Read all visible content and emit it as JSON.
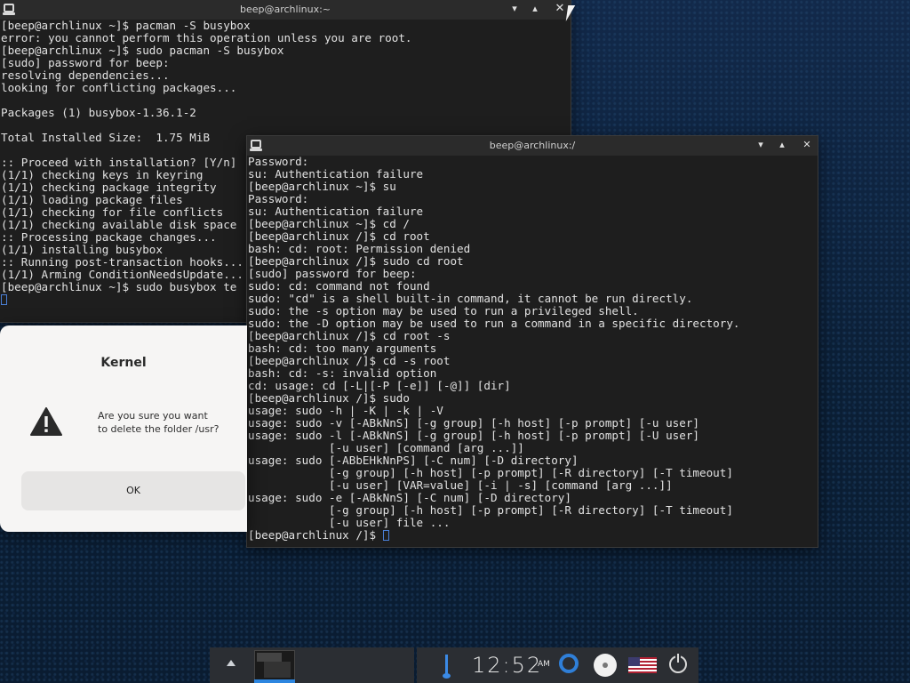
{
  "terminal1": {
    "title": "beep@archlinux:~",
    "minimize": "▾",
    "maximize": "▴",
    "close": "✕",
    "lines": [
      "[beep@archlinux ~]$ pacman -S busybox",
      "error: you cannot perform this operation unless you are root.",
      "[beep@archlinux ~]$ sudo pacman -S busybox",
      "[sudo] password for beep:",
      "resolving dependencies...",
      "looking for conflicting packages...",
      "",
      "Packages (1) busybox-1.36.1-2",
      "",
      "Total Installed Size:  1.75 MiB",
      "",
      ":: Proceed with installation? [Y/n]",
      "(1/1) checking keys in keyring",
      "(1/1) checking package integrity",
      "(1/1) loading package files",
      "(1/1) checking for file conflicts",
      "(1/1) checking available disk space",
      ":: Processing package changes...",
      "(1/1) installing busybox",
      ":: Running post-transaction hooks...",
      "(1/1) Arming ConditionNeedsUpdate...",
      "[beep@archlinux ~]$ sudo busybox te"
    ]
  },
  "terminal2": {
    "title": "beep@archlinux:/",
    "minimize": "▾",
    "maximize": "▴",
    "close": "✕",
    "lines": [
      "Password:",
      "su: Authentication failure",
      "[beep@archlinux ~]$ su",
      "Password:",
      "su: Authentication failure",
      "[beep@archlinux ~]$ cd /",
      "[beep@archlinux /]$ cd root",
      "bash: cd: root: Permission denied",
      "[beep@archlinux /]$ sudo cd root",
      "[sudo] password for beep:",
      "sudo: cd: command not found",
      "sudo: \"cd\" is a shell built-in command, it cannot be run directly.",
      "sudo: the -s option may be used to run a privileged shell.",
      "sudo: the -D option may be used to run a command in a specific directory.",
      "[beep@archlinux /]$ cd root -s",
      "bash: cd: too many arguments",
      "[beep@archlinux /]$ cd -s root",
      "bash: cd: -s: invalid option",
      "cd: usage: cd [-L|[-P [-e]] [-@]] [dir]",
      "[beep@archlinux /]$ sudo",
      "usage: sudo -h | -K | -k | -V",
      "usage: sudo -v [-ABkNnS] [-g group] [-h host] [-p prompt] [-u user]",
      "usage: sudo -l [-ABkNnS] [-g group] [-h host] [-p prompt] [-U user]",
      "            [-u user] [command [arg ...]]",
      "usage: sudo [-ABbEHkNnPS] [-C num] [-D directory]",
      "            [-g group] [-h host] [-p prompt] [-R directory] [-T timeout]",
      "            [-u user] [VAR=value] [-i | -s] [command [arg ...]]",
      "usage: sudo -e [-ABkNnS] [-C num] [-D directory]",
      "            [-g group] [-h host] [-p prompt] [-R directory] [-T timeout]",
      "            [-u user] file ...",
      "[beep@archlinux /]$ "
    ]
  },
  "dialog": {
    "title": "Kernel",
    "message_line1": "Are you sure you want",
    "message_line2": "to delete the folder /usr?",
    "ok_label": "OK"
  },
  "taskbar": {
    "clock": "12:52",
    "ampm": "AM",
    "colors": {
      "accent": "#2d86e0",
      "panel": "#2b2e33"
    },
    "icons": [
      "show-desktop-arrow-icon",
      "window-thumbnail",
      "ring-icon",
      "disc-icon",
      "us-flag-icon",
      "power-icon"
    ]
  }
}
